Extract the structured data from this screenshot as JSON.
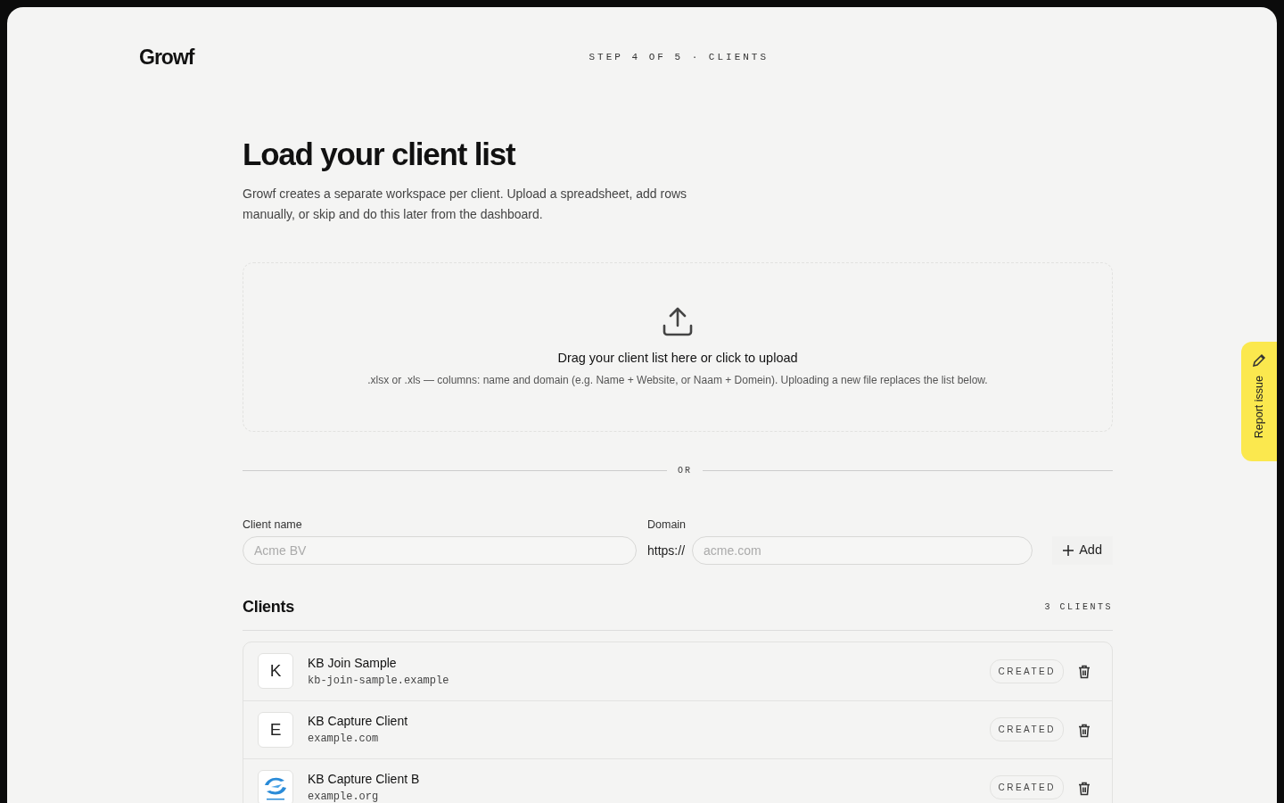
{
  "brand": "Growf",
  "step": "STEP 4 OF 5 · CLIENTS",
  "title": "Load your client list",
  "intro": "Growf creates a separate workspace per client. Upload a spreadsheet, add rows manually, or skip and do this later from the dashboard.",
  "dropzone": {
    "title": "Drag your client list here or click to upload",
    "hint": ".xlsx or .xls — columns: name and domain (e.g. Name + Website, or Naam + Domein). Uploading a new file replaces the list below."
  },
  "divider": "OR",
  "form": {
    "name_label": "Client name",
    "name_placeholder": "Acme BV",
    "domain_label": "Domain",
    "domain_prefix": "https://",
    "domain_placeholder": "acme.com",
    "add_button": "Add"
  },
  "clients_heading": "Clients",
  "clients_count": "3 CLIENTS",
  "clients": [
    {
      "name": "KB Join Sample",
      "domain": "kb-join-sample.example",
      "avatar": {
        "kind": "letter",
        "text": "K"
      },
      "status": "CREATED"
    },
    {
      "name": "KB Capture Client",
      "domain": "example.com",
      "avatar": {
        "kind": "letter",
        "text": "E"
      },
      "status": "CREATED"
    },
    {
      "name": "KB Capture Client B",
      "domain": "example.org",
      "avatar": {
        "kind": "logo"
      },
      "status": "CREATED"
    }
  ],
  "report_button": "Report issue"
}
